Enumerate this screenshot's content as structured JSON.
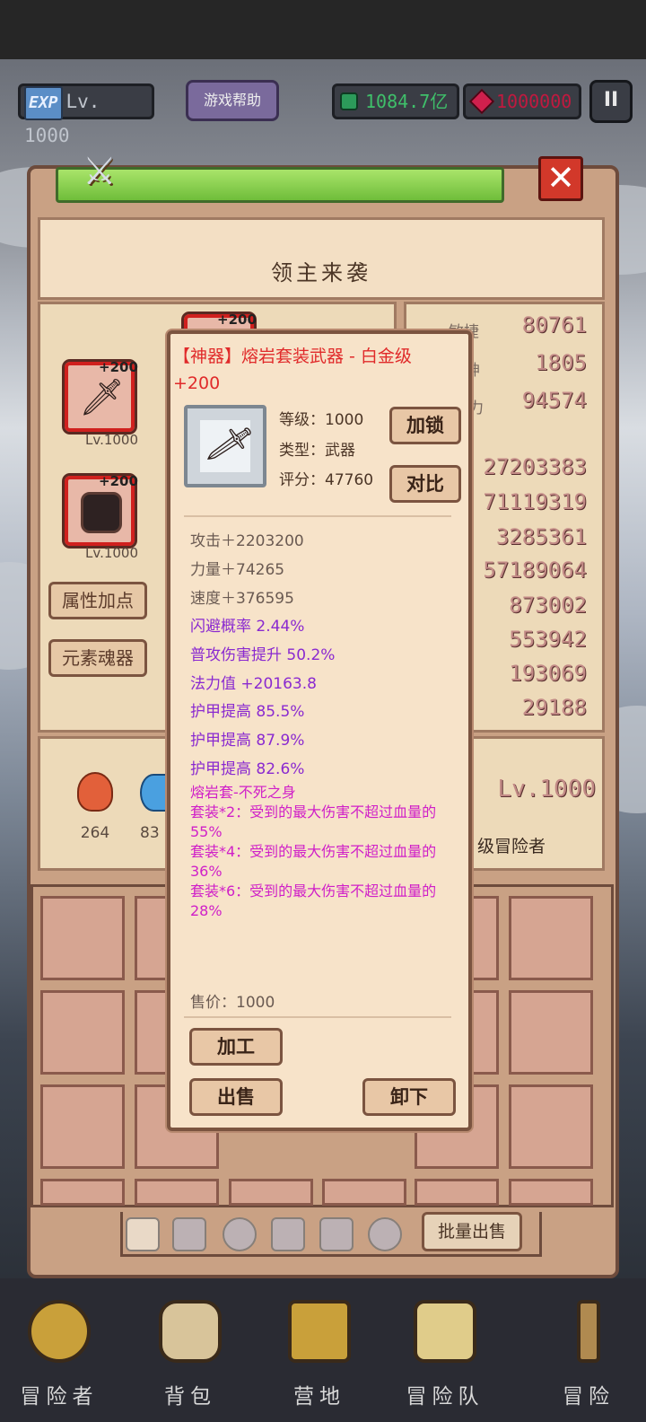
{
  "hud": {
    "exp_badge": "EXP",
    "level": "Lv. 1000",
    "help_label": "游戏帮助",
    "gems": "1084.7亿",
    "rubies": "1000000",
    "pause": "II"
  },
  "panel": {
    "title": "领主来袭",
    "slots": [
      {
        "plus": "+200",
        "level": "Lv.1000"
      },
      {
        "plus": "+200",
        "level": "Lv.1000"
      },
      {
        "plus": "+200"
      }
    ],
    "attr_button": "属性加点",
    "element_button": "元素魂器",
    "stats": [
      "80761",
      "1805",
      "94574",
      "27203383",
      "71119319",
      "3285361",
      "57189064",
      "873002",
      "553942",
      "193069",
      "29188"
    ],
    "stat_labels_partial": [
      "敏捷",
      "神",
      "力"
    ],
    "elements": [
      "264",
      "83"
    ],
    "hero_level": "Lv.1000",
    "hero_title": "级冒险者",
    "batch_sell": "批量出售"
  },
  "popup": {
    "title": "【神器】熔岩套装武器 - 白金级",
    "title_plus": "+200",
    "level": "等级：1000",
    "type": "类型：武器",
    "score": "评分：47760",
    "lock_button": "加锁",
    "compare_button": "对比",
    "base_stats": [
      "攻击＋2203200",
      "力量＋74265",
      "速度＋376595"
    ],
    "extra_stats": [
      "闪避概率 2.44%",
      "普攻伤害提升 50.2%",
      "法力值 +20163.8",
      "护甲提高 85.5%",
      "护甲提高 87.9%",
      "护甲提高 82.6%"
    ],
    "set_name": "熔岩套-不死之身",
    "set_bonuses": [
      "套装*2：受到的最大伤害不超过血量的55%",
      "套装*4：受到的最大伤害不超过血量的36%",
      "套装*6：受到的最大伤害不超过血量的28%"
    ],
    "price": "售价：1000",
    "craft_button": "加工",
    "sell_button": "出售",
    "unequip_button": "卸下"
  },
  "nav": {
    "items": [
      "冒险者",
      "背包",
      "营地",
      "冒险队",
      "冒险"
    ]
  },
  "colors": {
    "popup_title": "#e02a2a",
    "base_stat": "#6a5a52",
    "extra_stat": "#8a2ad0",
    "set_text": "#d020c8"
  }
}
